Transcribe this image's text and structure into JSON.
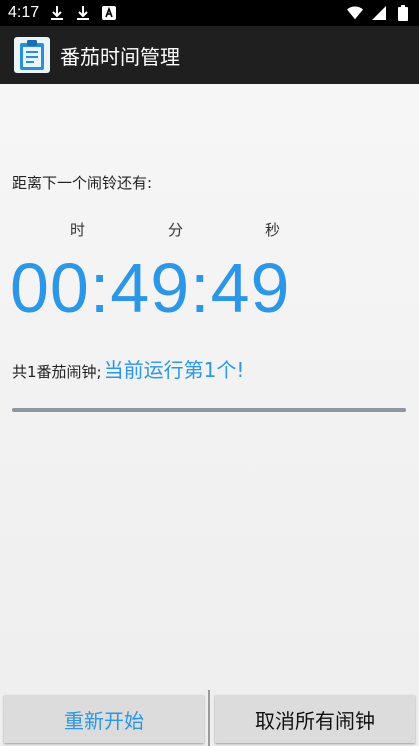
{
  "status_bar": {
    "time": "4:17",
    "icons": [
      "download-icon",
      "download-icon",
      "keyboard-a-icon",
      "wifi-icon",
      "signal-icon",
      "battery-icon"
    ]
  },
  "app_bar": {
    "title": "番茄时间管理",
    "icon": "clipboard-icon"
  },
  "countdown": {
    "label": "距离下一个闹铃还有:",
    "unit_hour": "时",
    "unit_minute": "分",
    "unit_second": "秒",
    "time": "00:49:49"
  },
  "summary": {
    "total": "共1番茄闹钟;",
    "current": "当前运行第1个!"
  },
  "progress": {
    "value": 1.0
  },
  "buttons": {
    "restart": "重新开始",
    "cancel_all": "取消所有闹钟"
  },
  "colors": {
    "accent": "#2c97e6",
    "app_bar": "#1f1f1f",
    "status_bar": "#000000"
  }
}
